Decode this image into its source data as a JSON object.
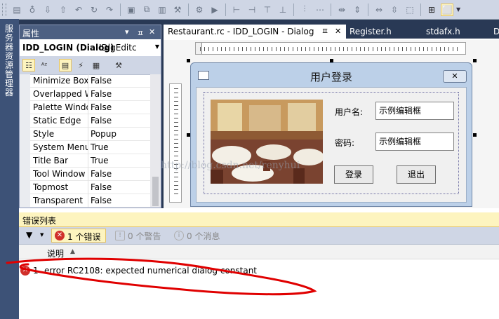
{
  "left_tab": {
    "label": "服务器资源管理器"
  },
  "properties": {
    "title": "属性",
    "pin": "▾ ㅍ ✕",
    "object_name": "IDD_LOGIN (Dialog)",
    "object_class": "IDlgEditc",
    "rows": [
      {
        "name": "Minimize Box",
        "value": "False"
      },
      {
        "name": "Overlapped Window",
        "value": "False"
      },
      {
        "name": "Palette Window",
        "value": "False"
      },
      {
        "name": "Static Edge",
        "value": "False"
      },
      {
        "name": "Style",
        "value": "Popup"
      },
      {
        "name": "System Menu",
        "value": "True"
      },
      {
        "name": "Title Bar",
        "value": "True"
      },
      {
        "name": "Tool Window",
        "value": "False"
      },
      {
        "name": "Topmost",
        "value": "False"
      },
      {
        "name": "Transparent",
        "value": "False"
      }
    ]
  },
  "tabs": [
    {
      "label": "Restaurant.rc - IDD_LOGIN - Dialog",
      "pin": "ㅍ",
      "close": "✕"
    },
    {
      "label": "Register.h"
    },
    {
      "label": "stdafx.h"
    },
    {
      "label": "D"
    }
  ],
  "dialog": {
    "title": "用户登录",
    "close": "✕",
    "username_label": "用户名:",
    "username_value": "示例编辑框",
    "password_label": "密码:",
    "password_value": "示例编辑框",
    "login_button": "登录",
    "exit_button": "退出"
  },
  "watermark": "http://blog.csdn.net/renyhui",
  "error_list": {
    "title": "错误列表",
    "errors_filter": "1 个错误",
    "warnings_filter": "0 个警告",
    "messages_filter": "0 个消息",
    "column_description": "说明",
    "rows": [
      {
        "index": "1",
        "description": "error RC2108: expected numerical dialog constant"
      }
    ]
  },
  "colors": {
    "accent_yellow": "#fdf4bf",
    "panel_blue": "#293955",
    "error_red": "#d0302b",
    "scribble_red": "#e00000"
  }
}
